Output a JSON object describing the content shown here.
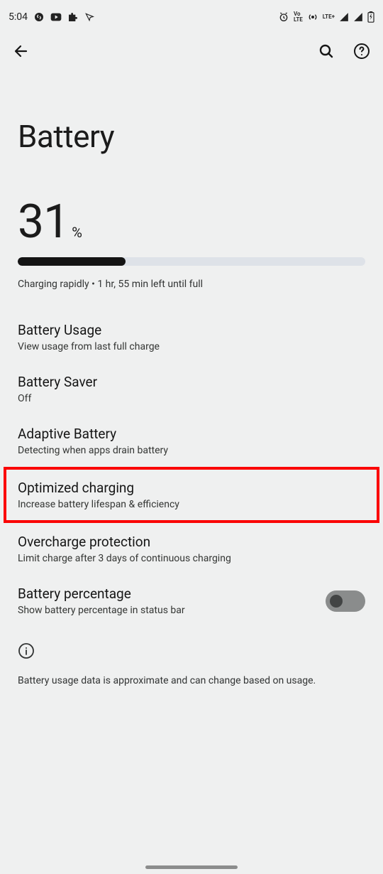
{
  "status_bar": {
    "time": "5:04",
    "net1_label": "Vo\nLTE",
    "net2_label": "LTE+"
  },
  "page": {
    "title": "Battery"
  },
  "battery": {
    "percent": "31",
    "percent_unit": "%",
    "fill_width": "31%",
    "charging_text": "Charging rapidly • 1 hr, 55 min left until full"
  },
  "items": {
    "usage": {
      "title": "Battery Usage",
      "sub": "View usage from last full charge"
    },
    "saver": {
      "title": "Battery Saver",
      "sub": "Off"
    },
    "adaptive": {
      "title": "Adaptive Battery",
      "sub": "Detecting when apps drain battery"
    },
    "optimized": {
      "title": "Optimized charging",
      "sub": "Increase battery lifespan & efficiency"
    },
    "overcharge": {
      "title": "Overcharge protection",
      "sub": "Limit charge after 3 days of continuous charging"
    },
    "percentage": {
      "title": "Battery percentage",
      "sub": "Show battery percentage in status bar"
    }
  },
  "footer": {
    "note": "Battery usage data is approximate and can change based on usage."
  }
}
